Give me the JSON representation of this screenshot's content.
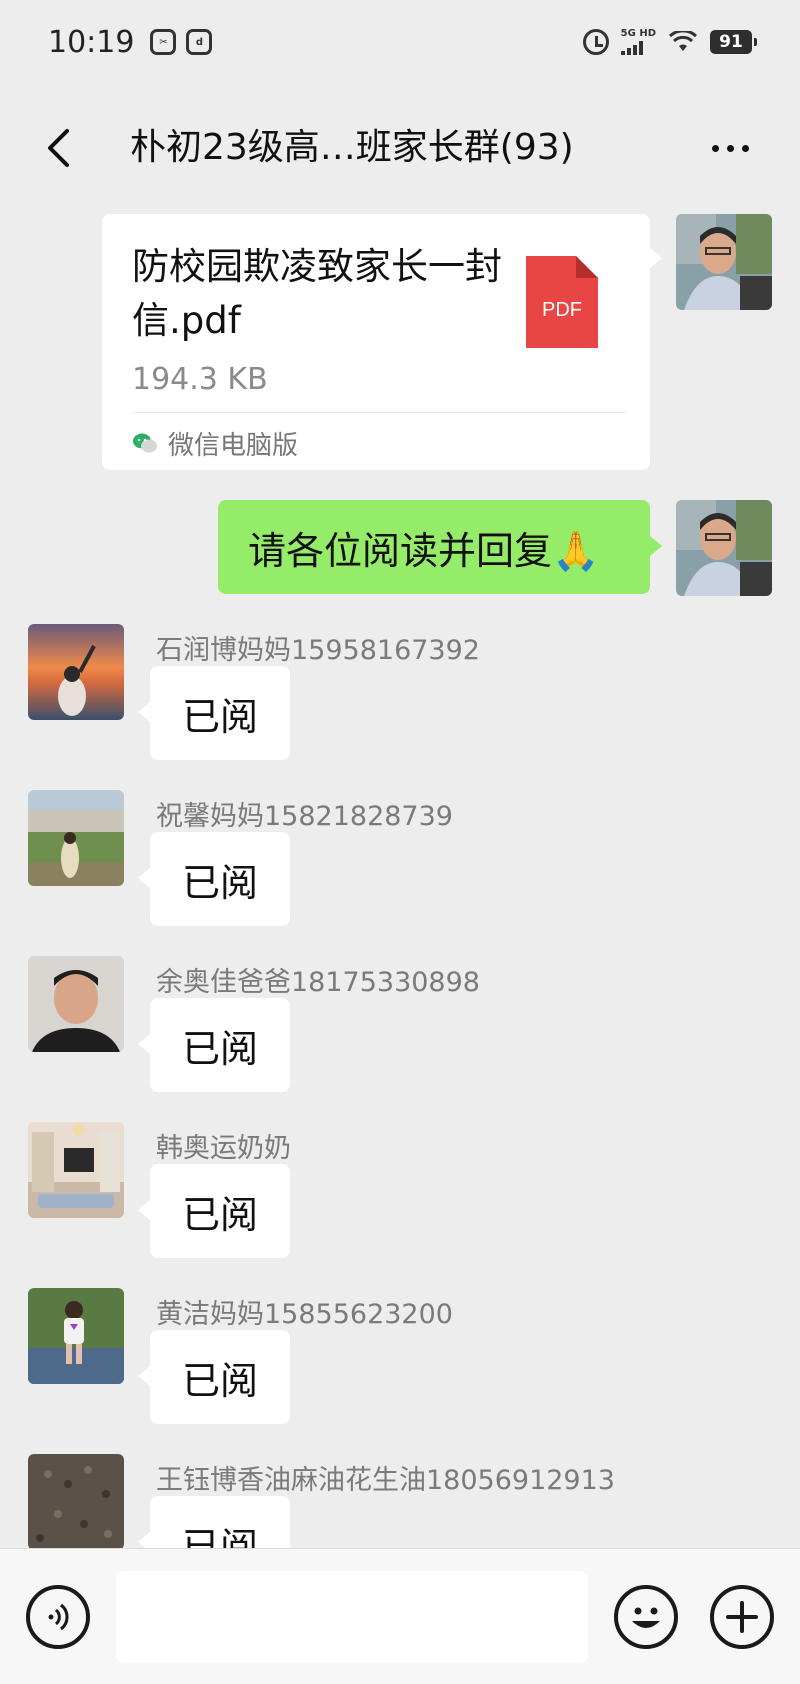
{
  "status_bar": {
    "time": "10:19",
    "network_label": "5G HD",
    "battery": "91",
    "apps": [
      "app-icon-1",
      "app-icon-2"
    ]
  },
  "nav": {
    "title": "朴初23级高…班家长群(93)"
  },
  "file_message": {
    "file_name": "防校园欺凌致家长一封信.pdf",
    "file_size": "194.3 KB",
    "file_type": "PDF",
    "source": "微信电脑版"
  },
  "text_message": {
    "text": "请各位阅读并回复🙏"
  },
  "replies": [
    {
      "sender": "石润博妈妈15958167392",
      "text": "已阅"
    },
    {
      "sender": "祝馨妈妈15821828739",
      "text": "已阅"
    },
    {
      "sender": "余奥佳爸爸18175330898",
      "text": "已阅"
    },
    {
      "sender": "韩奥运奶奶",
      "text": "已阅"
    },
    {
      "sender": "黄洁妈妈15855623200",
      "text": "已阅"
    },
    {
      "sender": "王钰博香油麻油花生油18056912913",
      "text": "已阅"
    }
  ],
  "input": {
    "value": "",
    "placeholder": ""
  },
  "colors": {
    "background": "#ededed",
    "green_bubble": "#95ec69",
    "pdf_red": "#e84545"
  }
}
